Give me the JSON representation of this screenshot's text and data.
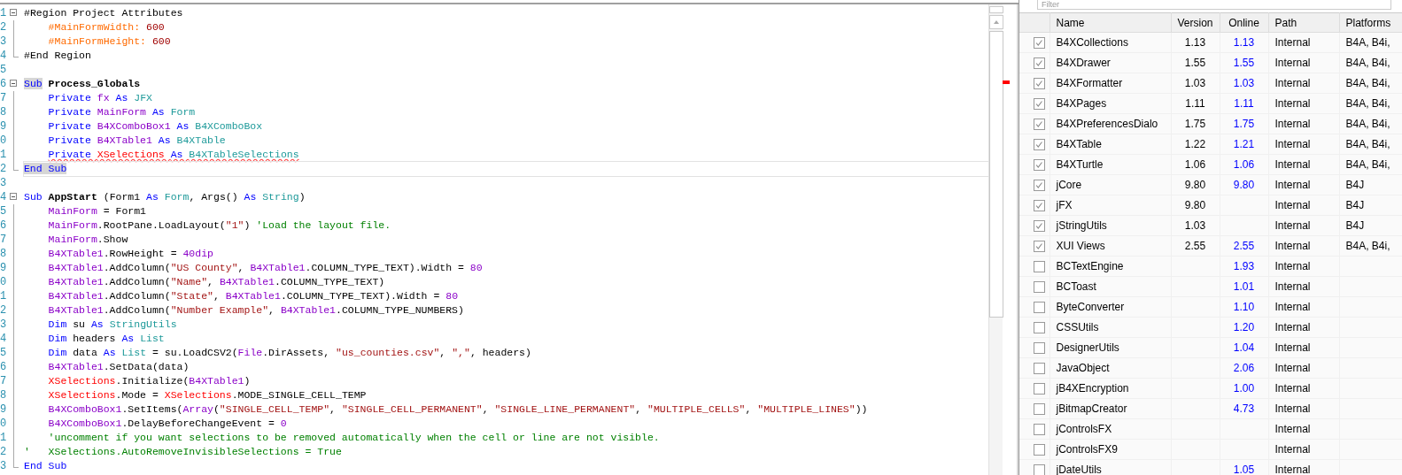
{
  "editor": {
    "lines": [
      {
        "number": "1",
        "collapsible": true,
        "block_end": false,
        "indented": false,
        "current": false,
        "squiggle": false,
        "tokens": [
          "#Region Project Attributes"
        ]
      },
      {
        "number": "2",
        "collapsible": false,
        "block_end": false,
        "indented": true,
        "current": false,
        "squiggle": false,
        "tokens": [
          {
            "kind": "directive",
            "text": "#MainFormWidth:"
          },
          {
            "kind": "number",
            "text": " 600"
          }
        ]
      },
      {
        "number": "3",
        "collapsible": false,
        "block_end": false,
        "indented": true,
        "current": false,
        "squiggle": false,
        "tokens": [
          {
            "kind": "directive",
            "text": "#MainFormHeight:"
          },
          {
            "kind": "number",
            "text": " 600"
          }
        ]
      },
      {
        "number": "4",
        "collapsible": false,
        "block_end": true,
        "indented": false,
        "current": false,
        "squiggle": false,
        "tokens": [
          "#End Region"
        ]
      },
      {
        "number": "5",
        "collapsible": false,
        "block_end": false,
        "current": false,
        "squiggle": false
      },
      {
        "number": "6",
        "collapsible": true,
        "block_end": false,
        "indented": false,
        "current": false,
        "squiggle": false,
        "tokens": [
          {
            "kind": "match",
            "text": "Sub"
          },
          {
            "kind": "bold",
            "text": " Process_Globals"
          }
        ]
      },
      {
        "number": "7",
        "collapsible": false,
        "block_end": false,
        "indented": true,
        "current": false,
        "squiggle": false,
        "tokens": [
          {
            "kind": "keyword",
            "text": "Private "
          },
          {
            "kind": "variable",
            "text": "fx "
          },
          {
            "kind": "keyword",
            "text": "As "
          },
          {
            "kind": "type",
            "text": "JFX"
          }
        ]
      },
      {
        "number": "8",
        "collapsible": false,
        "block_end": false,
        "indented": true,
        "current": false,
        "squiggle": false,
        "tokens": [
          {
            "kind": "keyword",
            "text": "Private "
          },
          {
            "kind": "variable",
            "text": "MainForm "
          },
          {
            "kind": "keyword",
            "text": "As "
          },
          {
            "kind": "type",
            "text": "Form"
          }
        ]
      },
      {
        "number": "9",
        "collapsible": false,
        "block_end": false,
        "indented": true,
        "current": false,
        "squiggle": false,
        "tokens": [
          {
            "kind": "keyword",
            "text": "Private "
          },
          {
            "kind": "variable",
            "text": "B4XComboBox1 "
          },
          {
            "kind": "keyword",
            "text": "As "
          },
          {
            "kind": "type",
            "text": "B4XComboBox"
          }
        ]
      },
      {
        "number": "0",
        "collapsible": false,
        "block_end": false,
        "indented": true,
        "current": false,
        "squiggle": false,
        "tokens": [
          {
            "kind": "keyword",
            "text": "Private "
          },
          {
            "kind": "variable",
            "text": "B4XTable1 "
          },
          {
            "kind": "keyword",
            "text": "As "
          },
          {
            "kind": "type",
            "text": "B4XTable"
          }
        ]
      },
      {
        "number": "1",
        "collapsible": false,
        "block_end": false,
        "indented": true,
        "current": false,
        "squiggle": true,
        "tokens": [
          {
            "kind": "keyword",
            "text": "Private "
          },
          {
            "kind": "error",
            "text": "XSelections "
          },
          {
            "kind": "keyword",
            "text": "As "
          },
          {
            "kind": "type",
            "text": "B4XTableSelections"
          }
        ]
      },
      {
        "number": "2",
        "collapsible": false,
        "block_end": true,
        "indented": false,
        "current": true,
        "squiggle": false,
        "tokens": [
          {
            "kind": "match",
            "text": "End Sub"
          }
        ]
      },
      {
        "number": "3",
        "collapsible": false,
        "block_end": false,
        "current": false,
        "squiggle": false
      },
      {
        "number": "4",
        "collapsible": true,
        "block_end": false,
        "indented": false,
        "current": false,
        "squiggle": false,
        "tokens": [
          {
            "kind": "keyword",
            "text": "Sub "
          },
          {
            "kind": "bold",
            "text": "AppStart"
          },
          " (Form1 ",
          {
            "kind": "keyword",
            "text": "As "
          },
          {
            "kind": "type",
            "text": "Form"
          },
          ", Args() ",
          {
            "kind": "keyword",
            "text": "As "
          },
          {
            "kind": "type",
            "text": "String"
          },
          ")"
        ]
      },
      {
        "number": "5",
        "collapsible": false,
        "block_end": false,
        "indented": true,
        "current": false,
        "squiggle": false,
        "tokens": [
          {
            "kind": "variable",
            "text": "MainForm"
          },
          " = Form1"
        ]
      },
      {
        "number": "6",
        "collapsible": false,
        "block_end": false,
        "indented": true,
        "current": false,
        "squiggle": false,
        "tokens": [
          {
            "kind": "variable",
            "text": "MainForm"
          },
          ".RootPane.LoadLayout(",
          {
            "kind": "string",
            "text": "\"1\""
          },
          ") ",
          {
            "kind": "comment",
            "text": "'Load the layout file."
          }
        ]
      },
      {
        "number": "7",
        "collapsible": false,
        "block_end": false,
        "indented": true,
        "current": false,
        "squiggle": false,
        "tokens": [
          {
            "kind": "variable",
            "text": "MainForm"
          },
          ".Show"
        ]
      },
      {
        "number": "8",
        "collapsible": false,
        "block_end": false,
        "indented": true,
        "current": false,
        "squiggle": false,
        "tokens": [
          {
            "kind": "variable",
            "text": "B4XTable1"
          },
          ".RowHeight = ",
          {
            "kind": "variable",
            "text": "40dip"
          }
        ]
      },
      {
        "number": "9",
        "collapsible": false,
        "block_end": false,
        "indented": true,
        "current": false,
        "squiggle": false,
        "tokens": [
          {
            "kind": "variable",
            "text": "B4XTable1"
          },
          ".AddColumn(",
          {
            "kind": "string",
            "text": "\"US County\""
          },
          ", ",
          {
            "kind": "variable",
            "text": "B4XTable1"
          },
          ".COLUMN_TYPE_TEXT).Width = ",
          {
            "kind": "variable",
            "text": "80"
          }
        ]
      },
      {
        "number": "0",
        "collapsible": false,
        "block_end": false,
        "indented": true,
        "current": false,
        "squiggle": false,
        "tokens": [
          {
            "kind": "variable",
            "text": "B4XTable1"
          },
          ".AddColumn(",
          {
            "kind": "string",
            "text": "\"Name\""
          },
          ", ",
          {
            "kind": "variable",
            "text": "B4XTable1"
          },
          ".COLUMN_TYPE_TEXT)"
        ]
      },
      {
        "number": "1",
        "collapsible": false,
        "block_end": false,
        "indented": true,
        "current": false,
        "squiggle": false,
        "tokens": [
          {
            "kind": "variable",
            "text": "B4XTable1"
          },
          ".AddColumn(",
          {
            "kind": "string",
            "text": "\"State\""
          },
          ", ",
          {
            "kind": "variable",
            "text": "B4XTable1"
          },
          ".COLUMN_TYPE_TEXT).Width = ",
          {
            "kind": "variable",
            "text": "80"
          }
        ]
      },
      {
        "number": "2",
        "collapsible": false,
        "block_end": false,
        "indented": true,
        "current": false,
        "squiggle": false,
        "tokens": [
          {
            "kind": "variable",
            "text": "B4XTable1"
          },
          ".AddColumn(",
          {
            "kind": "string",
            "text": "\"Number Example\""
          },
          ", ",
          {
            "kind": "variable",
            "text": "B4XTable1"
          },
          ".COLUMN_TYPE_NUMBERS)"
        ]
      },
      {
        "number": "3",
        "collapsible": false,
        "block_end": false,
        "indented": true,
        "current": false,
        "squiggle": false,
        "tokens": [
          {
            "kind": "keyword",
            "text": "Dim"
          },
          " su ",
          {
            "kind": "keyword",
            "text": "As "
          },
          {
            "kind": "type",
            "text": "StringUtils"
          }
        ]
      },
      {
        "number": "4",
        "collapsible": false,
        "block_end": false,
        "indented": true,
        "current": false,
        "squiggle": false,
        "tokens": [
          {
            "kind": "keyword",
            "text": "Dim"
          },
          " headers ",
          {
            "kind": "keyword",
            "text": "As "
          },
          {
            "kind": "type",
            "text": "List"
          }
        ]
      },
      {
        "number": "5",
        "collapsible": false,
        "block_end": false,
        "indented": true,
        "current": false,
        "squiggle": false,
        "tokens": [
          {
            "kind": "keyword",
            "text": "Dim"
          },
          " data ",
          {
            "kind": "keyword",
            "text": "As "
          },
          {
            "kind": "type",
            "text": "List"
          },
          " = su.LoadCSV2(",
          {
            "kind": "variable",
            "text": "File"
          },
          ".DirAssets, ",
          {
            "kind": "string",
            "text": "\"us_counties.csv\""
          },
          ", ",
          {
            "kind": "string",
            "text": "\",\""
          },
          ", headers)"
        ]
      },
      {
        "number": "6",
        "collapsible": false,
        "block_end": false,
        "indented": true,
        "current": false,
        "squiggle": false,
        "tokens": [
          {
            "kind": "variable",
            "text": "B4XTable1"
          },
          ".SetData(data)"
        ]
      },
      {
        "number": "7",
        "collapsible": false,
        "block_end": false,
        "indented": true,
        "current": false,
        "squiggle": false,
        "tokens": [
          {
            "kind": "error",
            "text": "XSelections"
          },
          ".Initialize(",
          {
            "kind": "variable",
            "text": "B4XTable1"
          },
          ")"
        ]
      },
      {
        "number": "8",
        "collapsible": false,
        "block_end": false,
        "indented": true,
        "current": false,
        "squiggle": false,
        "tokens": [
          {
            "kind": "error",
            "text": "XSelections"
          },
          ".Mode = ",
          {
            "kind": "error",
            "text": "XSelections"
          },
          ".MODE_SINGLE_CELL_TEMP"
        ]
      },
      {
        "number": "9",
        "collapsible": false,
        "block_end": false,
        "indented": true,
        "current": false,
        "squiggle": false,
        "tokens": [
          {
            "kind": "variable",
            "text": "B4XComboBox1"
          },
          ".SetItems(",
          {
            "kind": "variable",
            "text": "Array"
          },
          "(",
          {
            "kind": "string",
            "text": "\"SINGLE_CELL_TEMP\""
          },
          ", ",
          {
            "kind": "string",
            "text": "\"SINGLE_CELL_PERMANENT\""
          },
          ", ",
          {
            "kind": "string",
            "text": "\"SINGLE_LINE_PERMANENT\""
          },
          ", ",
          {
            "kind": "string",
            "text": "\"MULTIPLE_CELLS\""
          },
          ", ",
          {
            "kind": "string",
            "text": "\"MULTIPLE_LINES\""
          },
          "))"
        ]
      },
      {
        "number": "0",
        "collapsible": false,
        "block_end": false,
        "indented": true,
        "current": false,
        "squiggle": false,
        "tokens": [
          {
            "kind": "variable",
            "text": "B4XComboBox1"
          },
          ".DelayBeforeChangeEvent = ",
          {
            "kind": "variable",
            "text": "0"
          }
        ]
      },
      {
        "number": "1",
        "collapsible": false,
        "block_end": false,
        "indented": true,
        "current": false,
        "squiggle": false,
        "tokens": [
          {
            "kind": "comment",
            "text": "'uncomment if you want selections to be removed automatically when the cell or line are not visible."
          }
        ]
      },
      {
        "number": "2",
        "collapsible": false,
        "block_end": false,
        "indented": false,
        "current": false,
        "squiggle": false,
        "tokens": [
          {
            "kind": "comment",
            "text": "'   XSelections.AutoRemoveInvisibleSelections = True"
          }
        ]
      },
      {
        "number": "3",
        "collapsible": false,
        "block_end": true,
        "indented": false,
        "current": false,
        "squiggle": false,
        "tokens": [
          {
            "kind": "keyword",
            "text": "End Sub"
          }
        ]
      }
    ]
  },
  "libraries": {
    "filter": {
      "placeholder": "Filter"
    },
    "columns": [
      "Name",
      "Version",
      "Online",
      "Path",
      "Platforms"
    ],
    "rows": [
      {
        "checked": true,
        "name": "B4XCollections",
        "version": "1.13",
        "online": "1.13",
        "path": "Internal",
        "platforms": "B4A, B4i,"
      },
      {
        "checked": true,
        "name": "B4XDrawer",
        "version": "1.55",
        "online": "1.55",
        "path": "Internal",
        "platforms": "B4A, B4i,"
      },
      {
        "checked": true,
        "name": "B4XFormatter",
        "version": "1.03",
        "online": "1.03",
        "path": "Internal",
        "platforms": "B4A, B4i,"
      },
      {
        "checked": true,
        "name": "B4XPages",
        "version": "1.11",
        "online": "1.11",
        "path": "Internal",
        "platforms": "B4A, B4i,"
      },
      {
        "checked": true,
        "name": "B4XPreferencesDialo",
        "version": "1.75",
        "online": "1.75",
        "path": "Internal",
        "platforms": "B4A, B4i,"
      },
      {
        "checked": true,
        "name": "B4XTable",
        "version": "1.22",
        "online": "1.21",
        "path": "Internal",
        "platforms": "B4A, B4i,"
      },
      {
        "checked": true,
        "name": "B4XTurtle",
        "version": "1.06",
        "online": "1.06",
        "path": "Internal",
        "platforms": "B4A, B4i,"
      },
      {
        "checked": true,
        "name": "jCore",
        "version": "9.80",
        "online": "9.80",
        "path": "Internal",
        "platforms": "B4J"
      },
      {
        "checked": true,
        "name": "jFX",
        "version": "9.80",
        "path": "Internal",
        "platforms": "B4J"
      },
      {
        "checked": true,
        "name": "jStringUtils",
        "version": "1.03",
        "path": "Internal",
        "platforms": "B4J"
      },
      {
        "checked": true,
        "name": "XUI Views",
        "version": "2.55",
        "online": "2.55",
        "path": "Internal",
        "platforms": "B4A, B4i,"
      },
      {
        "checked": false,
        "name": "BCTextEngine",
        "online": "1.93",
        "path": "Internal"
      },
      {
        "checked": false,
        "name": "BCToast",
        "online": "1.01",
        "path": "Internal"
      },
      {
        "checked": false,
        "name": "ByteConverter",
        "online": "1.10",
        "path": "Internal"
      },
      {
        "checked": false,
        "name": "CSSUtils",
        "online": "1.20",
        "path": "Internal"
      },
      {
        "checked": false,
        "name": "DesignerUtils",
        "online": "1.04",
        "path": "Internal"
      },
      {
        "checked": false,
        "name": "JavaObject",
        "online": "2.06",
        "path": "Internal"
      },
      {
        "checked": false,
        "name": "jB4XEncryption",
        "online": "1.00",
        "path": "Internal"
      },
      {
        "checked": false,
        "name": "jBitmapCreator",
        "online": "4.73",
        "path": "Internal"
      },
      {
        "checked": false,
        "name": "jControlsFX",
        "path": "Internal"
      },
      {
        "checked": false,
        "name": "jControlsFX9",
        "path": "Internal"
      },
      {
        "checked": false,
        "name": "jDateUtils",
        "online": "1.05",
        "path": "Internal"
      }
    ]
  }
}
